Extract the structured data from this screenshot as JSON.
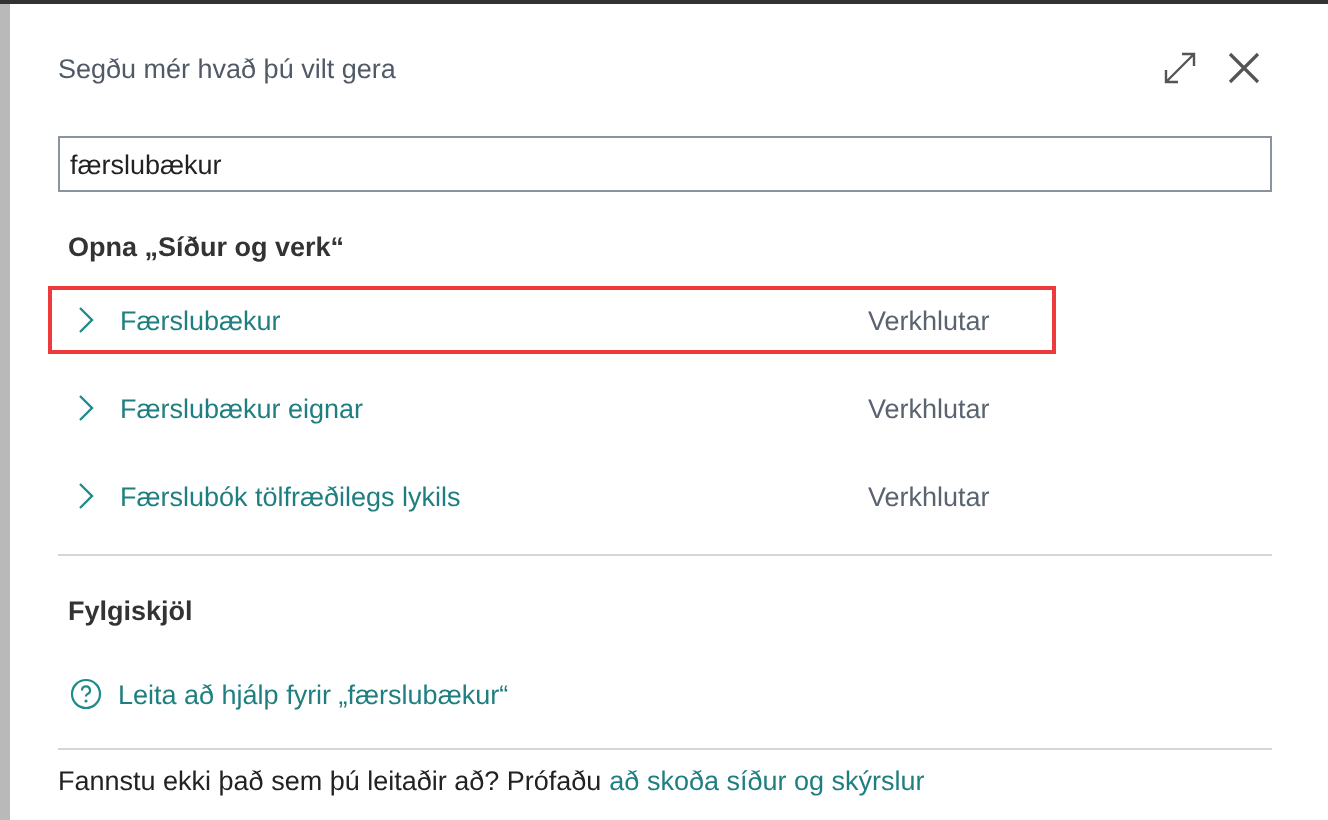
{
  "dialog": {
    "title": "Segðu mér hvað þú vilt gera"
  },
  "search": {
    "value": "færslubækur"
  },
  "sections": [
    {
      "heading": "Opna „Síður og verk“",
      "kind": "results",
      "rows": [
        {
          "label": "Færslubækur",
          "type": "Verkhlutar",
          "selected": true
        },
        {
          "label": "Færslubækur eignar",
          "type": "Verkhlutar",
          "selected": false
        },
        {
          "label": "Færslubók tölfræðilegs lykils",
          "type": "Verkhlutar",
          "selected": false
        }
      ]
    },
    {
      "heading": "Fylgiskjöl",
      "kind": "help",
      "link": "Leita að hjálp fyrir „færslubækur“"
    }
  ],
  "footer": {
    "text": "Fannstu ekki það sem þú leitaðir að? Prófaðu",
    "link": "að skoða síður og skýrslur"
  }
}
